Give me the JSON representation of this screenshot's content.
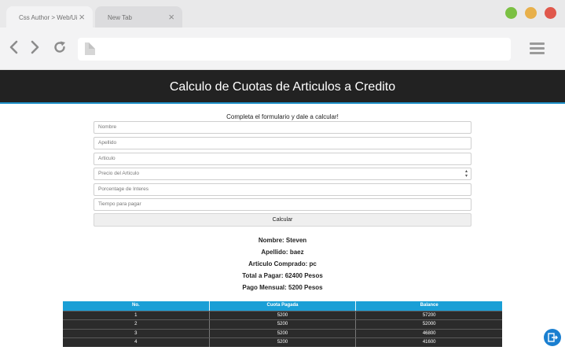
{
  "browser": {
    "tabs": [
      {
        "label": "Css Author > Web/Ui",
        "active": true
      },
      {
        "label": "New Tab",
        "active": false
      }
    ],
    "window_dots": [
      "#7bc043",
      "#e8b04b",
      "#e0584c"
    ],
    "url": ""
  },
  "page": {
    "title": "Calculo de Cuotas de Articulos a Credito",
    "intro": "Completa el formulario y dale a calcular!",
    "fields": {
      "nombre": "Nombre",
      "apellido": "Apellido",
      "articulo": "Articulo",
      "precio": "Precio del Articulo",
      "interes": "Porcentage de Interes",
      "tiempo": "Tiempo para pagar"
    },
    "calc_button": "Calcular",
    "results": {
      "nombre": "Nombre: Steven",
      "apellido": "Apellido: baez",
      "articulo": "Articulo Comprado: pc",
      "total": "Total a Pagar: 62400 Pesos",
      "mensual": "Pago Mensual: 5200 Pesos"
    },
    "table": {
      "headers": [
        "No.",
        "Cuota Pagada",
        "Balance"
      ],
      "rows": [
        [
          "1",
          "5200",
          "57200"
        ],
        [
          "2",
          "5200",
          "52000"
        ],
        [
          "3",
          "5200",
          "46800"
        ],
        [
          "4",
          "5200",
          "41600"
        ]
      ]
    }
  },
  "colors": {
    "header_bg": "#222222",
    "header_accent": "#1e90c8",
    "table_head": "#1a9fd6",
    "fab": "#1a7fd0"
  }
}
